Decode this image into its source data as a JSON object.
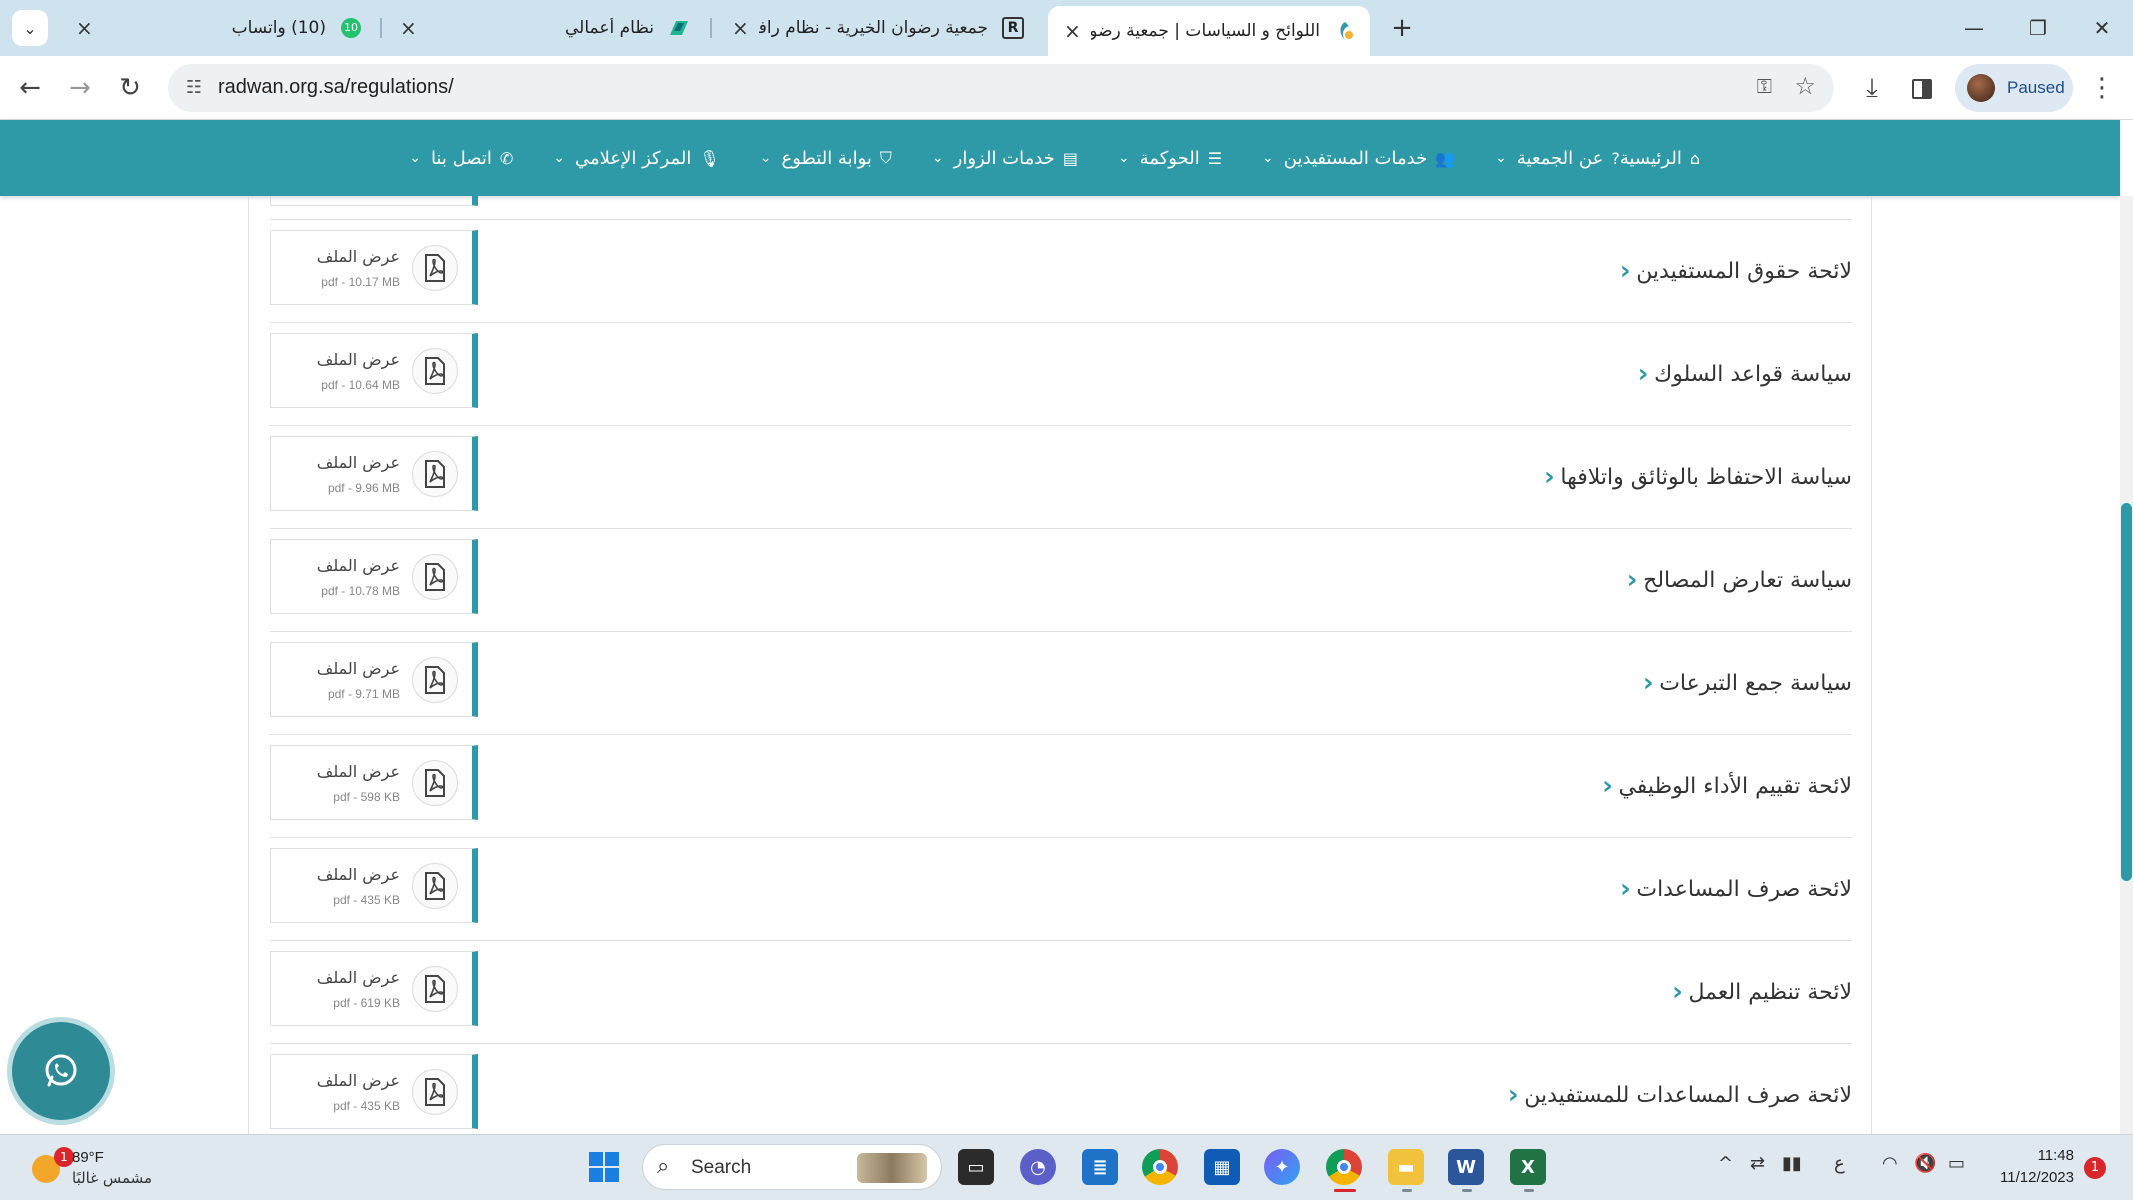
{
  "browser": {
    "tabs": [
      {
        "title": "(10) واتساب",
        "badge": "10",
        "active": false
      },
      {
        "title": "نظام أعمالي",
        "active": false
      },
      {
        "title": "جمعية رضوان الخيرية - نظام رافد",
        "fav": "R",
        "active": false
      },
      {
        "title": "اللوائح و السياسات | جمعية رضوان",
        "active": true
      }
    ],
    "new_tab": "+",
    "url": "radwan.org.sa/regulations/",
    "profile_status": "Paused"
  },
  "nav": {
    "items": [
      {
        "label": "الرئيسية",
        "icon": "home-icon",
        "has_dropdown": false
      },
      {
        "label": "عن الجمعية",
        "icon": "question-icon",
        "has_dropdown": true
      },
      {
        "label": "خدمات المستفيدين",
        "icon": "users-icon",
        "has_dropdown": true
      },
      {
        "label": "الحوكمة",
        "icon": "list-icon",
        "has_dropdown": true
      },
      {
        "label": "خدمات الزوار",
        "icon": "grid-icon",
        "has_dropdown": true
      },
      {
        "label": "بوابة التطوع",
        "icon": "gift-icon",
        "has_dropdown": true
      },
      {
        "label": "المركز الإعلامي",
        "icon": "microphone-icon",
        "has_dropdown": true
      },
      {
        "label": "اتصل بنا",
        "icon": "phone-icon",
        "has_dropdown": true
      }
    ]
  },
  "regulations": [
    {
      "title": "لائحة حقوق المستفيدين",
      "file_label": "عرض الملف",
      "file_meta": "pdf - 10.17 MB"
    },
    {
      "title": "سياسة قواعد السلوك",
      "file_label": "عرض الملف",
      "file_meta": "pdf - 10.64 MB"
    },
    {
      "title": "سياسة الاحتفاظ بالوثائق واتلافها",
      "file_label": "عرض الملف",
      "file_meta": "pdf - 9.96 MB"
    },
    {
      "title": "سياسة تعارض المصالح",
      "file_label": "عرض الملف",
      "file_meta": "pdf - 10.78 MB"
    },
    {
      "title": "سياسة جمع التبرعات",
      "file_label": "عرض الملف",
      "file_meta": "pdf - 9.71 MB"
    },
    {
      "title": "لائحة تقييم الأداء الوظيفي",
      "file_label": "عرض الملف",
      "file_meta": "pdf - 598 KB"
    },
    {
      "title": "لائحة صرف المساعدات",
      "file_label": "عرض الملف",
      "file_meta": "pdf - 435 KB"
    },
    {
      "title": "لائحة تنظيم العمل",
      "file_label": "عرض الملف",
      "file_meta": "pdf - 619 KB"
    },
    {
      "title": "لائحة صرف المساعدات للمستفيدين",
      "file_label": "عرض الملف",
      "file_meta": "pdf - 435 KB"
    }
  ],
  "taskbar": {
    "weather_temp": "89°F",
    "weather_condition": "مشمس غالبًا",
    "weather_badge": "1",
    "search_label": "Search",
    "keyboard_lang": "ع",
    "time": "11:48",
    "date": "11/12/2023",
    "notifications": "1"
  },
  "colors": {
    "accent": "#2e9aa7",
    "tabstrip": "#cfe3ef"
  }
}
